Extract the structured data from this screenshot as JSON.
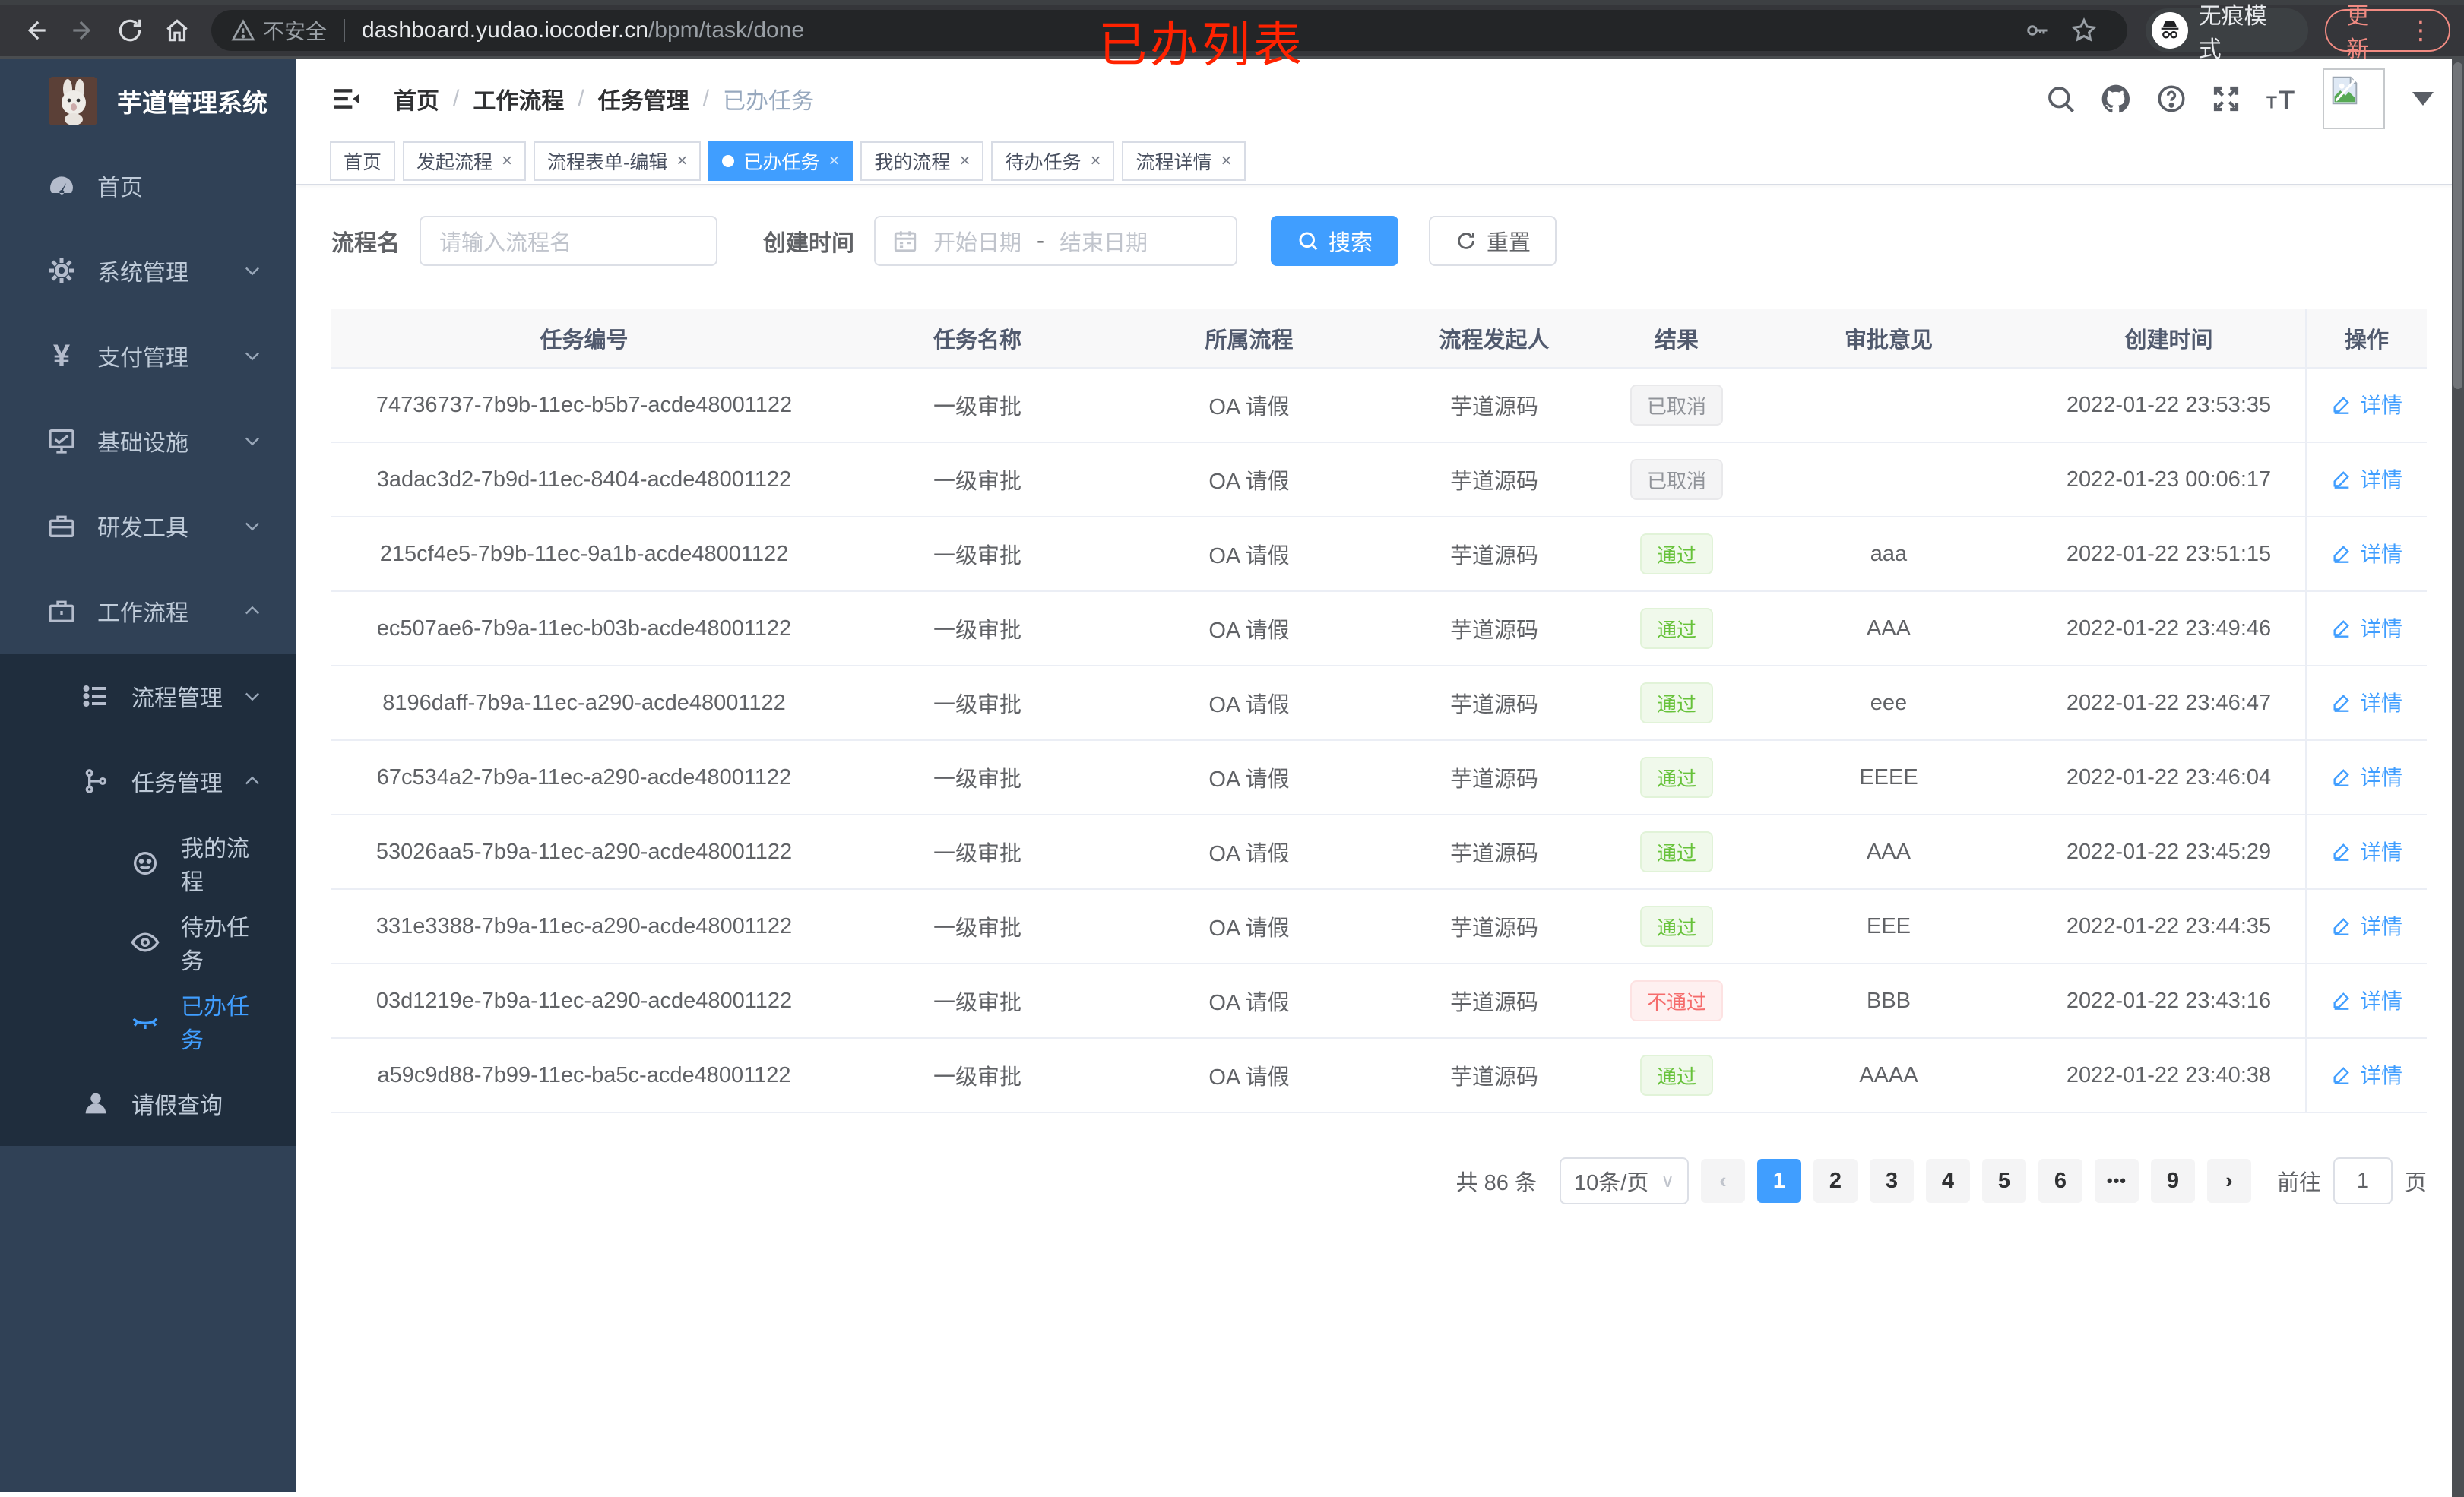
{
  "annotation": {
    "title": "已办列表"
  },
  "browser": {
    "security_label": "不安全",
    "url_host": "dashboard.yudao.iocoder.cn",
    "url_path": "/bpm/task/done",
    "incognito_label": "无痕模式",
    "update_label": "更新",
    "kebab_glyph": "⋮"
  },
  "sidebar": {
    "app_title": "芋道管理系统",
    "items": {
      "home": "首页",
      "system": "系统管理",
      "payment": "支付管理",
      "infra": "基础设施",
      "devtools": "研发工具",
      "workflow": "工作流程",
      "process_mgmt": "流程管理",
      "task_mgmt": "任务管理",
      "my_process": "我的流程",
      "todo_task": "待办任务",
      "done_task": "已办任务",
      "leave_query": "请假查询"
    }
  },
  "breadcrumb": {
    "items": [
      "首页",
      "工作流程",
      "任务管理",
      "已办任务"
    ],
    "separator": "/"
  },
  "tabs": {
    "close_glyph": "×",
    "items": [
      {
        "label": "首页"
      },
      {
        "label": "发起流程"
      },
      {
        "label": "流程表单-编辑"
      },
      {
        "label": "已办任务"
      },
      {
        "label": "我的流程"
      },
      {
        "label": "待办任务"
      },
      {
        "label": "流程详情"
      }
    ]
  },
  "filters": {
    "name_label": "流程名",
    "name_placeholder": "请输入流程名",
    "time_label": "创建时间",
    "start_placeholder": "开始日期",
    "range_separator": "-",
    "end_placeholder": "结束日期",
    "search_label": "搜索",
    "reset_label": "重置"
  },
  "table": {
    "columns": [
      "任务编号",
      "任务名称",
      "所属流程",
      "流程发起人",
      "结果",
      "审批意见",
      "创建时间",
      "操作"
    ],
    "action_label": "详情",
    "rows": [
      {
        "id": "74736737-7b9b-11ec-b5b7-acde48001122",
        "name": "一级审批",
        "process": "OA 请假",
        "starter": "芋道源码",
        "result": "已取消",
        "comment": "",
        "time": "2022-01-22 23:53:35"
      },
      {
        "id": "3adac3d2-7b9d-11ec-8404-acde48001122",
        "name": "一级审批",
        "process": "OA 请假",
        "starter": "芋道源码",
        "result": "已取消",
        "comment": "",
        "time": "2022-01-23 00:06:17"
      },
      {
        "id": "215cf4e5-7b9b-11ec-9a1b-acde48001122",
        "name": "一级审批",
        "process": "OA 请假",
        "starter": "芋道源码",
        "result": "通过",
        "comment": "aaa",
        "time": "2022-01-22 23:51:15"
      },
      {
        "id": "ec507ae6-7b9a-11ec-b03b-acde48001122",
        "name": "一级审批",
        "process": "OA 请假",
        "starter": "芋道源码",
        "result": "通过",
        "comment": "AAA",
        "time": "2022-01-22 23:49:46"
      },
      {
        "id": "8196daff-7b9a-11ec-a290-acde48001122",
        "name": "一级审批",
        "process": "OA 请假",
        "starter": "芋道源码",
        "result": "通过",
        "comment": "eee",
        "time": "2022-01-22 23:46:47"
      },
      {
        "id": "67c534a2-7b9a-11ec-a290-acde48001122",
        "name": "一级审批",
        "process": "OA 请假",
        "starter": "芋道源码",
        "result": "通过",
        "comment": "EEEE",
        "time": "2022-01-22 23:46:04"
      },
      {
        "id": "53026aa5-7b9a-11ec-a290-acde48001122",
        "name": "一级审批",
        "process": "OA 请假",
        "starter": "芋道源码",
        "result": "通过",
        "comment": "AAA",
        "time": "2022-01-22 23:45:29"
      },
      {
        "id": "331e3388-7b9a-11ec-a290-acde48001122",
        "name": "一级审批",
        "process": "OA 请假",
        "starter": "芋道源码",
        "result": "通过",
        "comment": "EEE",
        "time": "2022-01-22 23:44:35"
      },
      {
        "id": "03d1219e-7b9a-11ec-a290-acde48001122",
        "name": "一级审批",
        "process": "OA 请假",
        "starter": "芋道源码",
        "result": "不通过",
        "comment": "BBB",
        "time": "2022-01-22 23:43:16"
      },
      {
        "id": "a59c9d88-7b99-11ec-ba5c-acde48001122",
        "name": "一级审批",
        "process": "OA 请假",
        "starter": "芋道源码",
        "result": "通过",
        "comment": "AAAA",
        "time": "2022-01-22 23:40:38"
      }
    ]
  },
  "pagination": {
    "total_label": "共 86 条",
    "page_size_label": "10条/页",
    "select_caret": "∨",
    "prev_glyph": "‹",
    "next_glyph": "›",
    "pages": [
      "1",
      "2",
      "3",
      "4",
      "5",
      "6",
      "•••",
      "9"
    ],
    "goto_label": "前往",
    "goto_value": "1",
    "goto_suffix": "页"
  }
}
